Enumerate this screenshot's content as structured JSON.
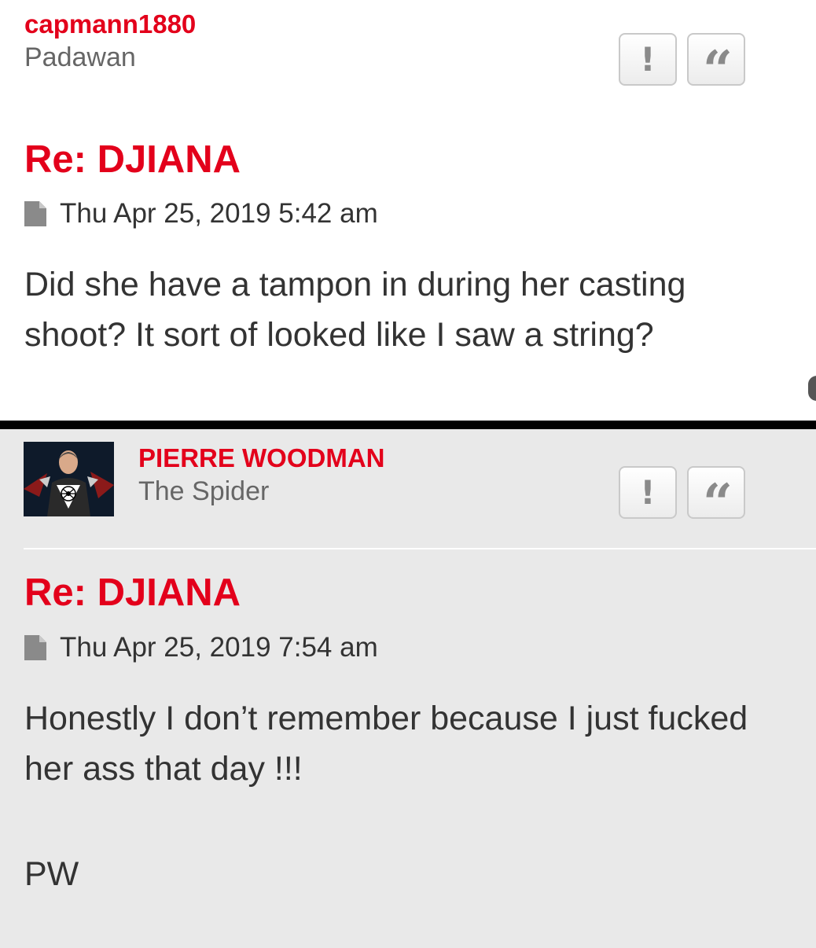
{
  "posts": [
    {
      "author": "capmann1880",
      "rank": "Padawan",
      "title": "Re: DJIANA",
      "date": "Thu Apr 25, 2019 5:42 am",
      "body_lines": [
        "Did she have a tampon in during her casting",
        "shoot? It sort of looked like I saw a string?"
      ],
      "report_label": "!",
      "quote_label": "“"
    },
    {
      "author": "PIERRE WOODMAN",
      "rank": "The Spider",
      "title": "Re: DJIANA",
      "date": "Thu Apr 25, 2019 7:54 am",
      "body_lines": [
        "Honestly I don’t remember because I just fucked",
        "her ass that day !!!"
      ],
      "signature": "PW",
      "report_label": "!",
      "quote_label": "“"
    }
  ],
  "colors": {
    "accent": "#e3001b",
    "post_bg_alt": "#e9e9e9",
    "text": "#333333",
    "muted": "#666666"
  },
  "icons": {
    "date": "document-icon",
    "report": "exclamation-icon",
    "quote": "quote-icon"
  }
}
